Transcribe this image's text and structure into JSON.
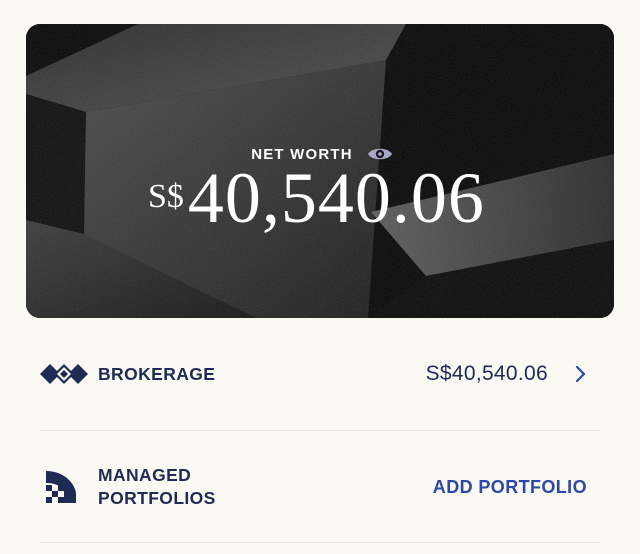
{
  "hero": {
    "label": "NET WORTH",
    "currency": "S$",
    "amount": "40,540.06"
  },
  "accounts": {
    "brokerage": {
      "title": "BROKERAGE",
      "value": "S$40,540.06"
    },
    "managed": {
      "title_line1": "MANAGED",
      "title_line2": "PORTFOLIOS",
      "action": "ADD PORTFOLIO"
    }
  },
  "colors": {
    "background": "#fbf9f4",
    "navy": "#1f2a55",
    "link_blue": "#2d48a8",
    "hero_bg": "#050505"
  },
  "icons": {
    "visibility": "eye-icon",
    "brokerage": "brokerage-diamond-logo-icon",
    "managed": "managed-portfolios-logo-icon",
    "navigate": "chevron-right-icon"
  }
}
